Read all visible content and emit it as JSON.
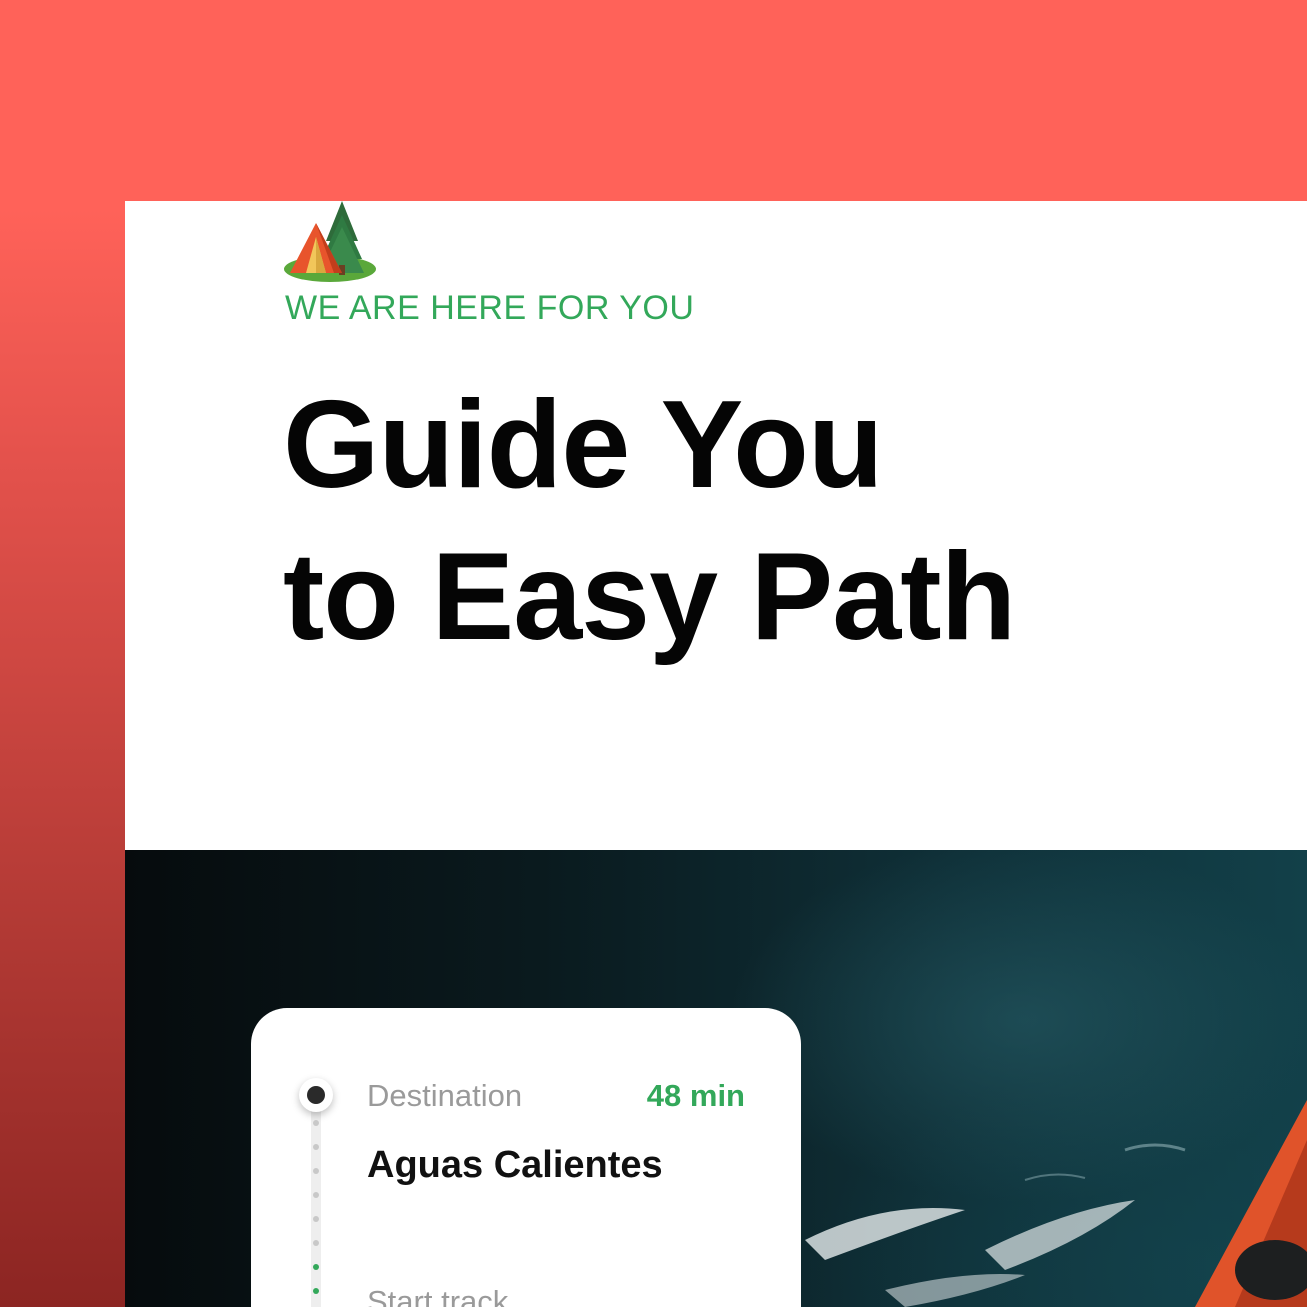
{
  "hero": {
    "icon": "camping-tent-icon",
    "eyebrow": "WE ARE HERE FOR YOU",
    "headline_line1": "Guide You",
    "headline_line2": "to Easy Path"
  },
  "colors": {
    "background": "#ff6259",
    "accent_green": "#33a85a",
    "headline": "#050505",
    "card": "#ffffff"
  },
  "route_card": {
    "destination_label": "Destination",
    "duration": "48 min",
    "destination_name": "Aguas Calientes",
    "start_label": "Start track"
  },
  "photo": {
    "subject": "kayak-on-dark-water"
  }
}
